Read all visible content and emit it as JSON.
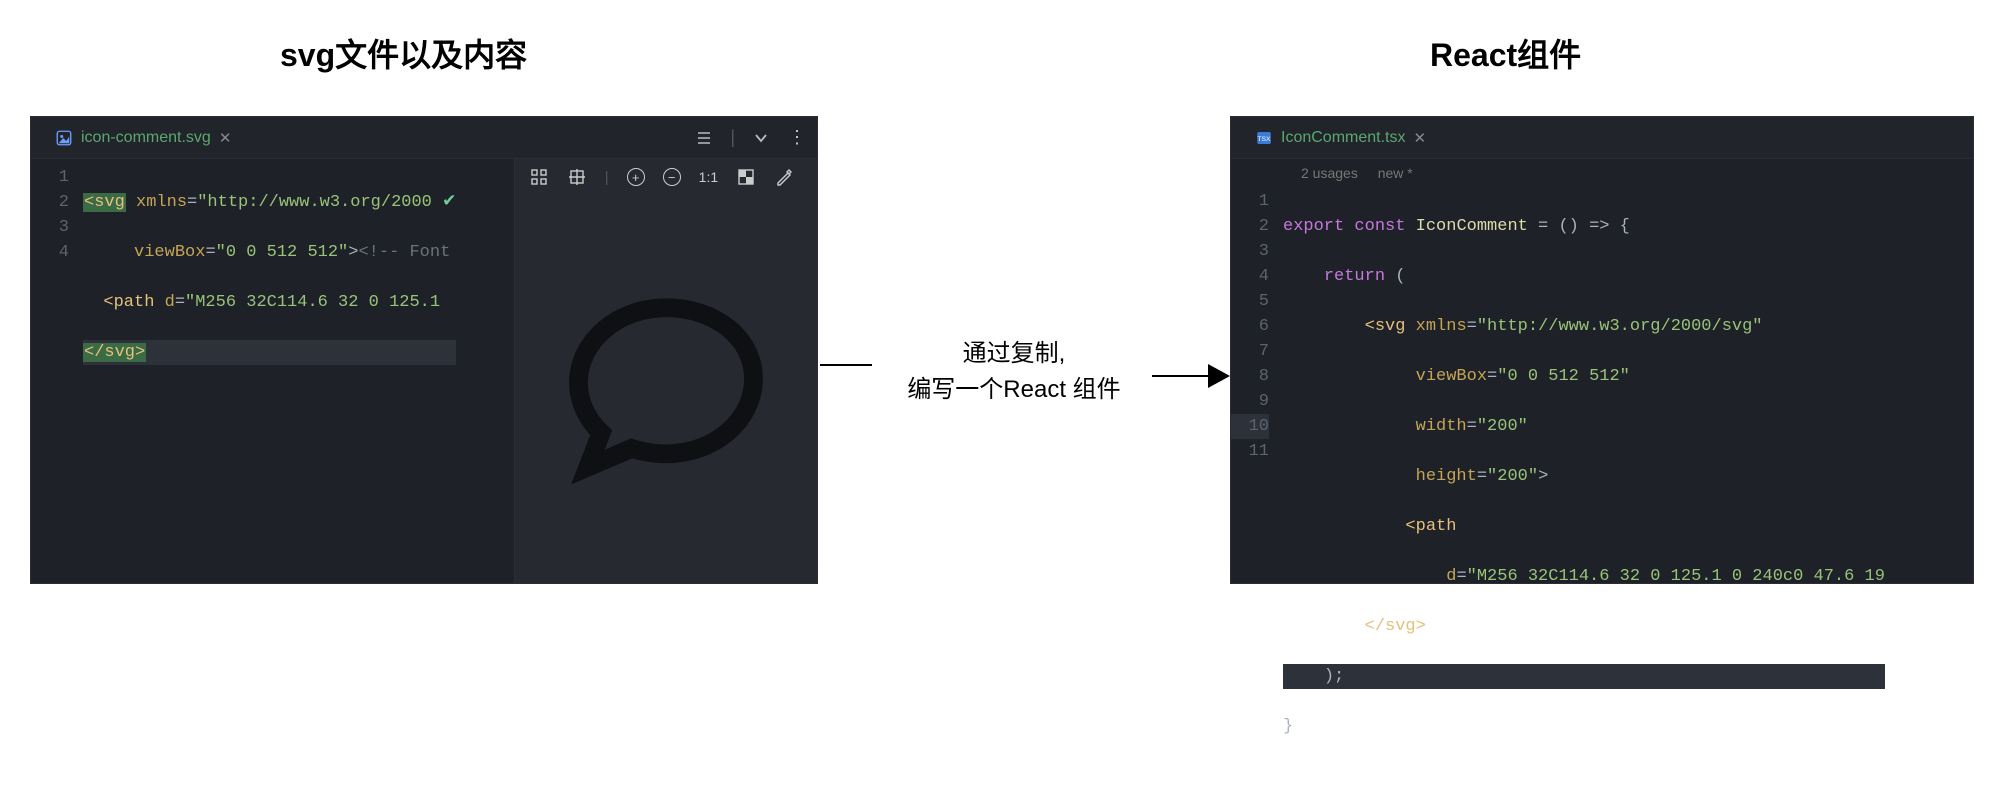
{
  "titles": {
    "left": "svg文件以及内容",
    "right": "React组件"
  },
  "arrow_caption": {
    "line1": "通过复制,",
    "line2": "编写一个React 组件"
  },
  "left_editor": {
    "tab": {
      "filename": "icon-comment.svg"
    },
    "toolbar_ratio": "1:1",
    "lines": {
      "l1": {
        "open": "<svg",
        "attr1": "xmlns",
        "val1": "\"http://www.w3.org/2000"
      },
      "l2": {
        "attr1": "viewBox",
        "val1": "\"0 0 512 512\"",
        "comment": "<!-- Font"
      },
      "l3": {
        "open": "<path",
        "attr1": "d",
        "val1": "\"M256 32C114.6 32 0 125.1"
      },
      "l4": {
        "close": "</svg>"
      }
    },
    "gutter": [
      "1",
      "2",
      "3",
      "4"
    ]
  },
  "right_editor": {
    "tab": {
      "filename": "IconComment.tsx"
    },
    "hints": {
      "usages": "2 usages",
      "new": "new *"
    },
    "lines": {
      "l1": {
        "kw1": "export",
        "kw2": "const",
        "name": "IconComment",
        "rest": " = () => {"
      },
      "l2": {
        "kw": "return",
        "rest": " ("
      },
      "l3": {
        "open": "<svg",
        "attr": "xmlns",
        "val": "\"http://www.w3.org/2000/svg\""
      },
      "l4": {
        "attr": "viewBox",
        "val": "\"0 0 512 512\""
      },
      "l5": {
        "attr": "width",
        "val": "\"200\""
      },
      "l6": {
        "attr": "height",
        "val": "\"200\"",
        "close": ">"
      },
      "l7": {
        "open": "<path"
      },
      "l8": {
        "attr": "d",
        "val": "\"M256 32C114.6 32 0 125.1 0 240c0 47.6 19"
      },
      "l9": {
        "close": "</svg>"
      },
      "l10": {
        "text": ");"
      },
      "l11": {
        "text": "}"
      }
    },
    "gutter": [
      "1",
      "2",
      "3",
      "4",
      "5",
      "6",
      "7",
      "8",
      "9",
      "10",
      "11"
    ]
  }
}
